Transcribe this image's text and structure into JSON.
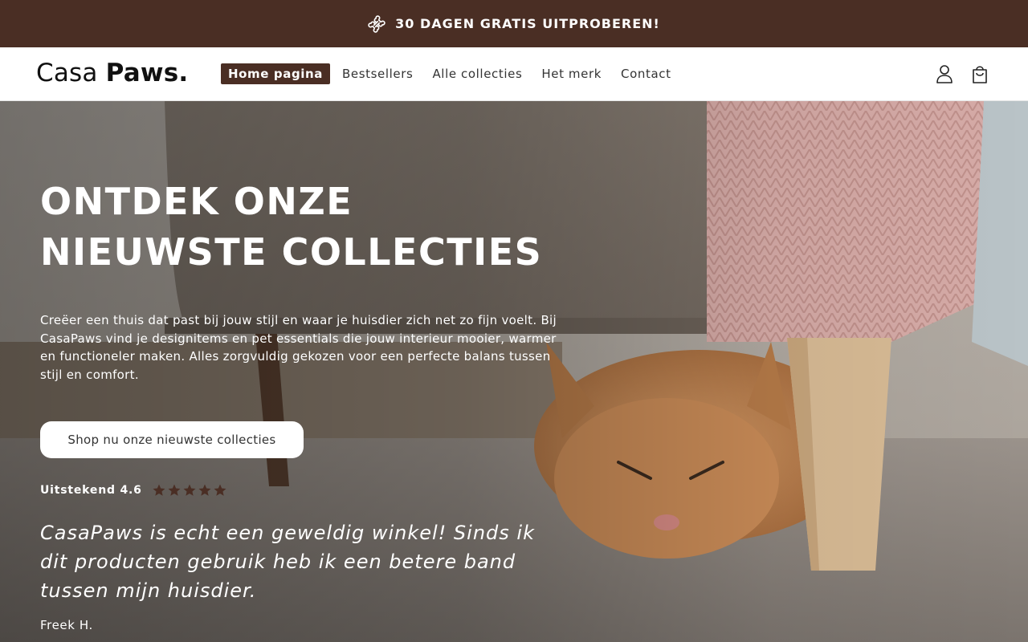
{
  "announcement": {
    "text": "30 DAGEN GRATIS UITPROBEREN!",
    "icon": "bone-icon",
    "background": "#4a2e24"
  },
  "header": {
    "logo_light": "Casa",
    "logo_bold": "Paws.",
    "nav": [
      {
        "label": "Home pagina",
        "active": true
      },
      {
        "label": "Bestsellers",
        "active": false
      },
      {
        "label": "Alle collecties",
        "active": false
      },
      {
        "label": "Het merk",
        "active": false
      },
      {
        "label": "Contact",
        "active": false
      }
    ],
    "icons": [
      "account-icon",
      "cart-icon"
    ],
    "accent": "#4a2e24"
  },
  "hero": {
    "title_lines": [
      "ONTDEK ONZE",
      "NIEUWSTE COLLECTIES"
    ],
    "description": "Creëer een thuis dat past bij jouw stijl en waar je huisdier zich net zo fijn voelt. Bij CasaPaws vind je designitems en pet essentials die jouw interieur mooier, warmer en functioneler maken. Alles zorgvuldig gekozen voor een perfecte balans tussen stijl en comfort.",
    "cta_label": "Shop nu onze nieuwste collecties",
    "rating_label": "Uitstekend 4.6",
    "stars": 5,
    "star_color": "#4a2e24",
    "quote_lines": [
      "CasaPaws is echt een geweldig winkel! Sinds ik",
      "dit producten gebruik heb ik een betere band",
      "tussen mijn huisdier."
    ],
    "author": "Freek H."
  }
}
